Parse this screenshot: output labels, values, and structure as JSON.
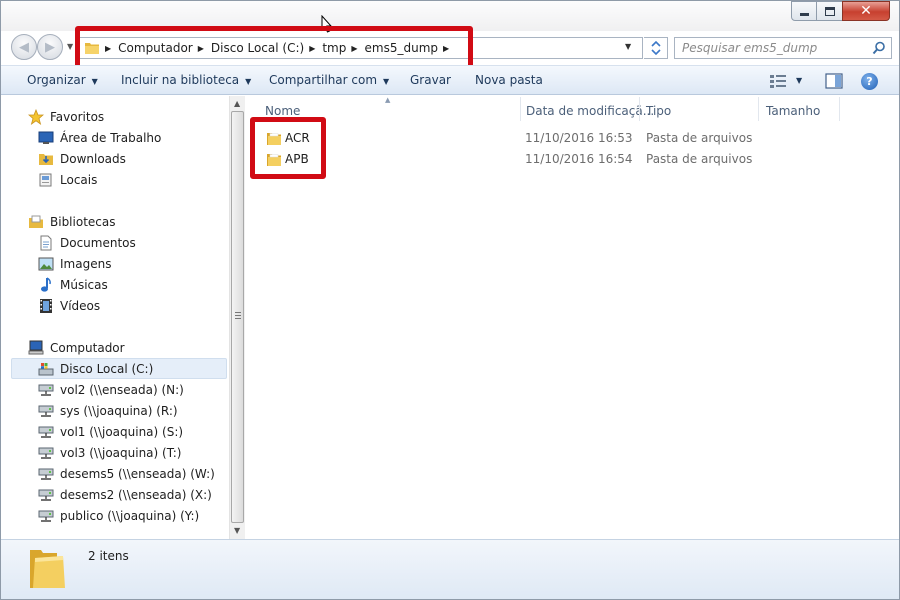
{
  "window": {
    "controls": {
      "close_glyph": "✕"
    }
  },
  "navigation": {
    "back_icon": "back-arrow-icon",
    "forward_icon": "forward-arrow-icon",
    "breadcrumbs": [
      "Computador",
      "Disco Local (C:)",
      "tmp",
      "ems5_dump"
    ],
    "search_placeholder": "Pesquisar ems5_dump"
  },
  "commandbar": {
    "items": [
      "Organizar",
      "Incluir na biblioteca",
      "Compartilhar com",
      "Gravar",
      "Nova pasta"
    ]
  },
  "navpane": {
    "favorites_header": "Favoritos",
    "favorites": [
      "Área de Trabalho",
      "Downloads",
      "Locais"
    ],
    "libraries_header": "Bibliotecas",
    "libraries": [
      "Documentos",
      "Imagens",
      "Músicas",
      "Vídeos"
    ],
    "computer_header": "Computador",
    "drives": [
      "Disco Local (C:)",
      "vol2 (\\\\enseada) (N:)",
      "sys (\\\\joaquina) (R:)",
      "vol1 (\\\\joaquina) (S:)",
      "vol3 (\\\\joaquina) (T:)",
      "desems5 (\\\\enseada) (W:)",
      "desems2 (\\\\enseada) (X:)",
      "publico (\\\\joaquina) (Y:)"
    ],
    "selected": "Disco Local (C:)"
  },
  "content": {
    "columns": [
      "Nome",
      "Data de modificaçã...",
      "Tipo",
      "Tamanho"
    ],
    "files": [
      {
        "name": "ACR",
        "modified": "11/10/2016 16:53",
        "type": "Pasta de arquivos"
      },
      {
        "name": "APB",
        "modified": "11/10/2016 16:54",
        "type": "Pasta de arquivos"
      }
    ]
  },
  "status": {
    "item_count": "2 itens"
  },
  "colors": {
    "highlight": "#d10b14",
    "folder": "#f0c64c",
    "accent": "#1e395b"
  }
}
